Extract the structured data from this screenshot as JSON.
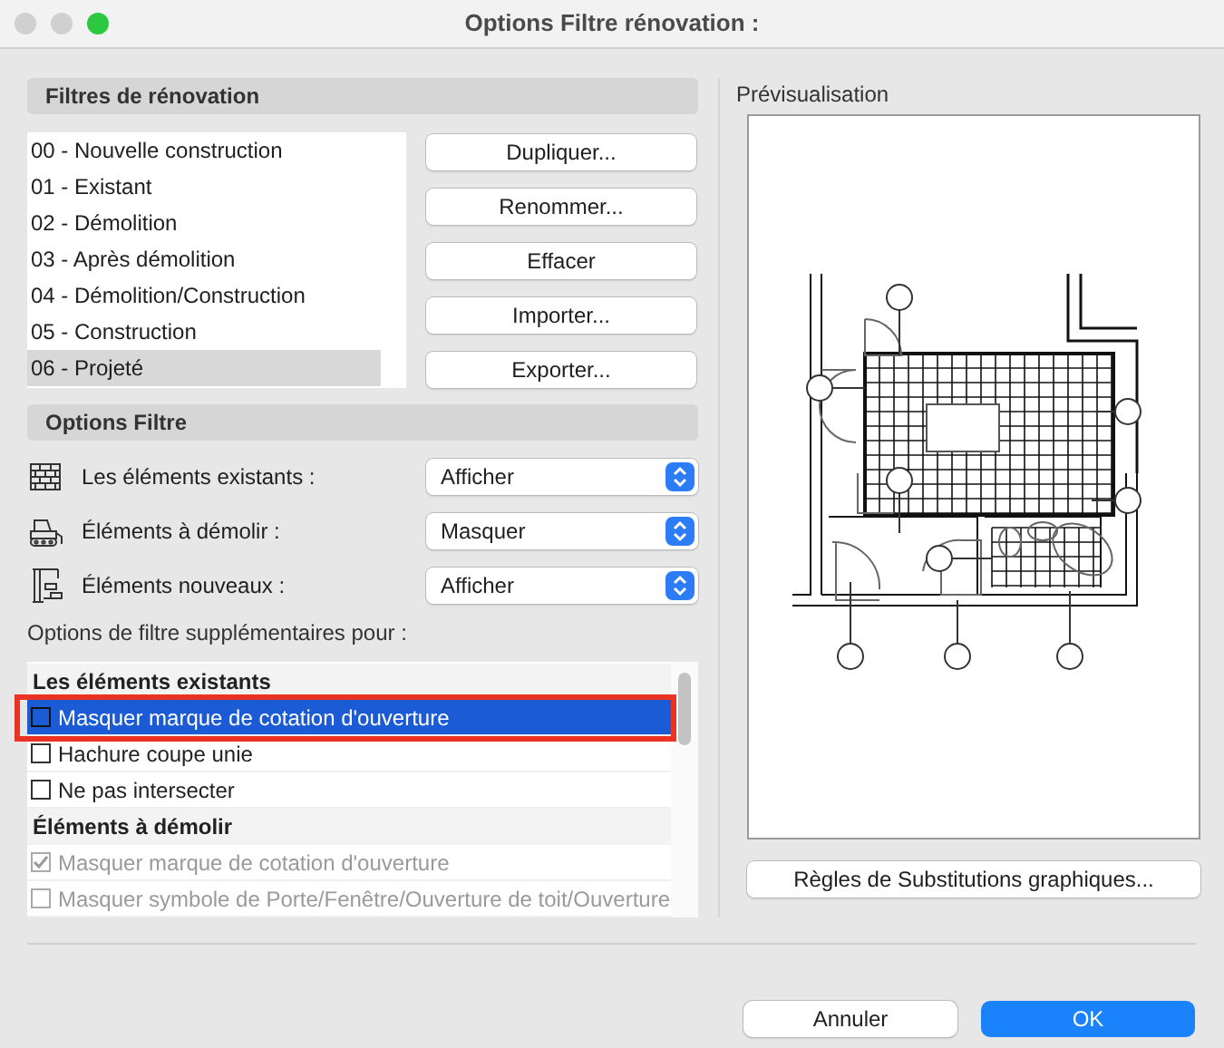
{
  "window": {
    "title": "Options Filtre rénovation :"
  },
  "filters": {
    "title": "Filtres de rénovation",
    "items": [
      {
        "label": "00 - Nouvelle construction",
        "selected": false
      },
      {
        "label": "01 - Existant",
        "selected": false
      },
      {
        "label": "02 - Démolition",
        "selected": false
      },
      {
        "label": "03 - Après démolition",
        "selected": false
      },
      {
        "label": "04 - Démolition/Construction",
        "selected": false
      },
      {
        "label": "05 - Construction",
        "selected": false
      },
      {
        "label": "06 - Projeté",
        "selected": true
      }
    ],
    "buttons": [
      "Dupliquer...",
      "Renommer...",
      "Effacer",
      "Importer...",
      "Exporter..."
    ]
  },
  "options": {
    "title": "Options Filtre",
    "rows": [
      {
        "kind": "wall",
        "label": "Les éléments existants :",
        "value": "Afficher"
      },
      {
        "kind": "bulldozer",
        "label": "Éléments à démolir :",
        "value": "Masquer"
      },
      {
        "kind": "crane",
        "label": "Éléments nouveaux :",
        "value": "Afficher"
      }
    ],
    "extra_label": "Options de filtre supplémentaires pour :",
    "list": [
      {
        "kind": "header",
        "label": "Les éléments existants"
      },
      {
        "kind": "checkbox",
        "label": "Masquer marque de cotation d'ouverture",
        "checked": false,
        "selected": true,
        "disabled": false,
        "highlighted": true
      },
      {
        "kind": "checkbox",
        "label": "Hachure coupe unie",
        "checked": false,
        "selected": false,
        "disabled": false,
        "highlighted": false
      },
      {
        "kind": "checkbox",
        "label": "Ne pas intersecter",
        "checked": false,
        "selected": false,
        "disabled": false,
        "highlighted": false
      },
      {
        "kind": "header",
        "label": "Éléments à démolir"
      },
      {
        "kind": "checkbox",
        "label": "Masquer marque de cotation d'ouverture",
        "checked": true,
        "selected": false,
        "disabled": true,
        "highlighted": false
      },
      {
        "kind": "checkbox",
        "label": "Masquer symbole de Porte/Fenêtre/Ouverture de toit/Ouverture",
        "checked": false,
        "selected": false,
        "disabled": true,
        "highlighted": false
      }
    ]
  },
  "preview": {
    "title": "Prévisualisation",
    "button": "Règles de Substitutions graphiques..."
  },
  "footer": {
    "cancel": "Annuler",
    "ok": "OK"
  }
}
